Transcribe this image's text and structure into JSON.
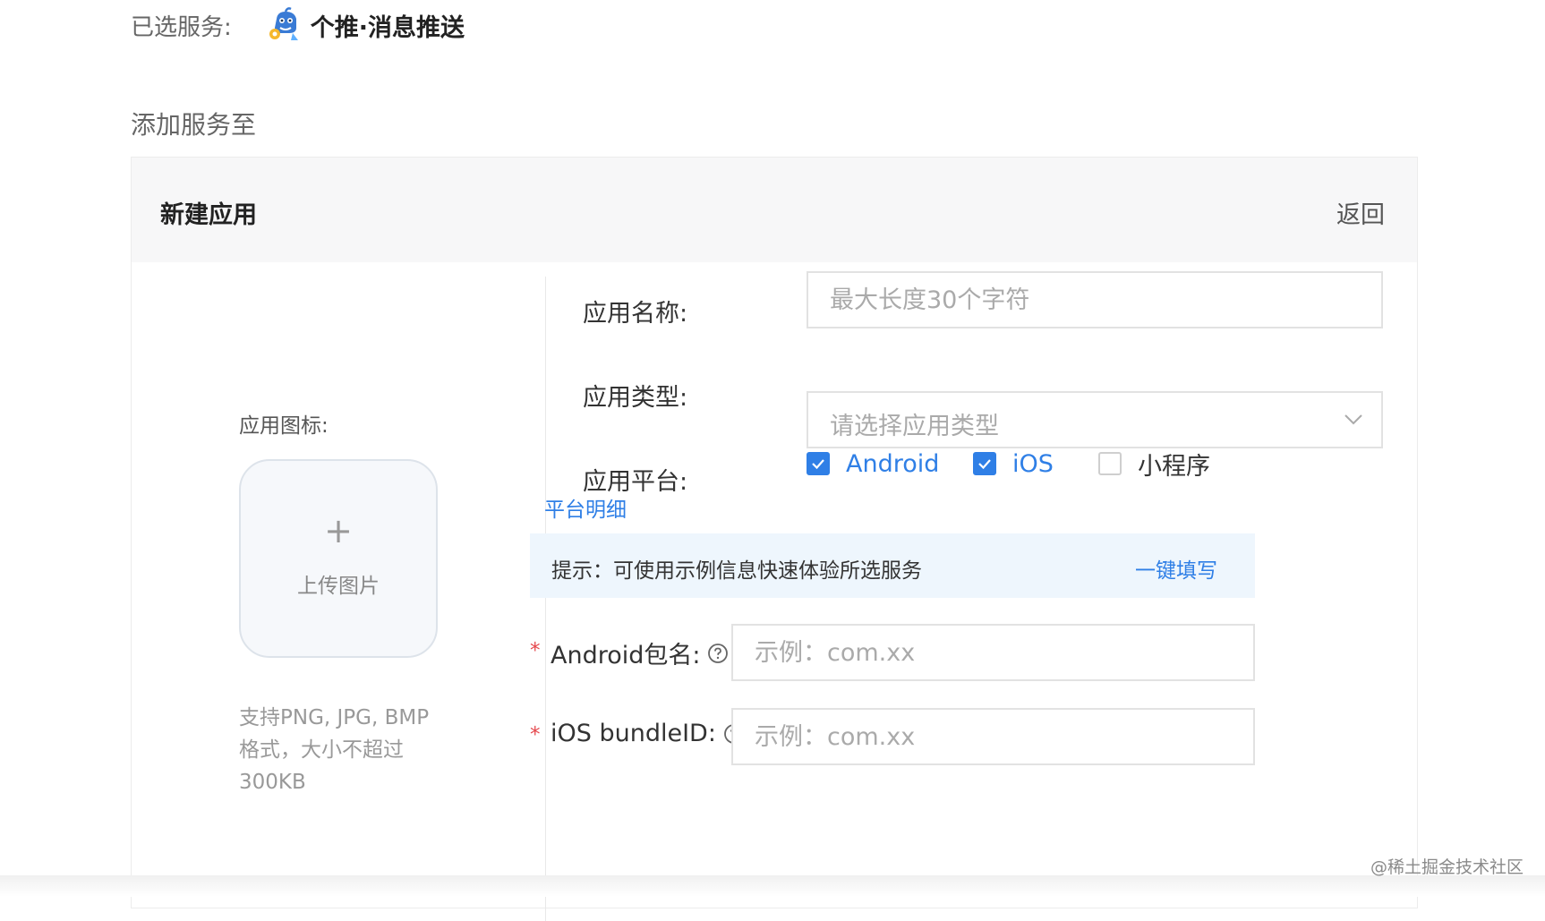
{
  "header": {
    "selected_label": "已选服务:",
    "service_name": "个推·消息推送",
    "service_icon": "getui-logo-icon",
    "add_to_label": "添加服务至"
  },
  "card": {
    "title": "新建应用",
    "back_label": "返回"
  },
  "upload": {
    "icon_label": "应用图标:",
    "plus_glyph": "+",
    "upload_text": "上传图片",
    "hint_lines": [
      "支持PNG, JPG, BMP",
      "格式，大小不超过",
      "300KB"
    ]
  },
  "form": {
    "app_name": {
      "label": "应用名称:",
      "placeholder": "最大长度30个字符",
      "value": ""
    },
    "app_type": {
      "label": "应用类型:",
      "placeholder": "请选择应用类型"
    },
    "platform": {
      "label": "应用平台:",
      "options": [
        {
          "label": "Android",
          "checked": true
        },
        {
          "label": "iOS",
          "checked": true
        },
        {
          "label": "小程序",
          "checked": false
        }
      ],
      "detail_link": "平台明细"
    },
    "tip": {
      "text": "提示：可使用示例信息快速体验所选服务",
      "action": "一键填写"
    },
    "android_package": {
      "required_mark": "*",
      "label": "Android包名:",
      "placeholder": "示例：com.xx",
      "value": ""
    },
    "ios_bundle": {
      "required_mark": "*",
      "label": "iOS bundleID:",
      "placeholder": "示例：com.xx",
      "value": ""
    }
  },
  "watermark": "@稀土掘金技术社区",
  "colors": {
    "accent": "#2f7fe6",
    "required": "#e5484d",
    "header_bg": "#f7f7f8",
    "tip_bg": "#eef6fd"
  }
}
